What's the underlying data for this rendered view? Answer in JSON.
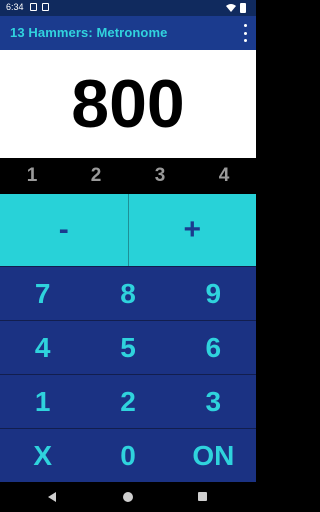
{
  "status_bar": {
    "time": "6:34",
    "icons": [
      "notification-a-icon",
      "notification-b-icon",
      "wifi-icon",
      "battery-icon"
    ]
  },
  "app_bar": {
    "title": "13 Hammers: Metronome",
    "menu_icon": "more-vert-icon"
  },
  "display": {
    "value": "800"
  },
  "beats": [
    "1",
    "2",
    "3",
    "4"
  ],
  "adjust": {
    "minus": "-",
    "plus": "+"
  },
  "keypad": [
    [
      "7",
      "8",
      "9"
    ],
    [
      "4",
      "5",
      "6"
    ],
    [
      "1",
      "2",
      "3"
    ],
    [
      "X",
      "0",
      "ON"
    ]
  ],
  "nav_bar": {
    "icons": [
      "back-icon",
      "home-icon",
      "recents-icon"
    ]
  },
  "colors": {
    "app_bar": "#1b3b8e",
    "accent": "#2fd3dd",
    "adjust_bg": "#28d2d8",
    "keypad_bg": "#1b3283"
  }
}
